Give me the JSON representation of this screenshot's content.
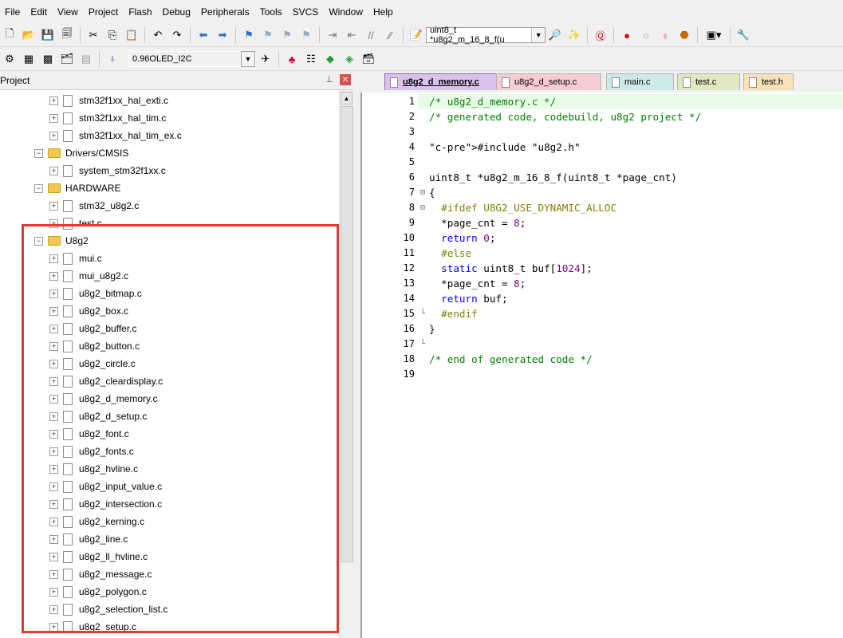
{
  "menu": [
    "File",
    "Edit",
    "View",
    "Project",
    "Flash",
    "Debug",
    "Peripherals",
    "Tools",
    "SVCS",
    "Window",
    "Help"
  ],
  "toolbar": {
    "function_combo": "uint8_t *u8g2_m_16_8_f(u",
    "target_combo": "0.96OLED_I2C"
  },
  "project": {
    "title": "Project",
    "pin_label": "⊥",
    "close_label": "✕",
    "tree": [
      {
        "label": "stm32f1xx_hal_exti.c",
        "type": "file"
      },
      {
        "label": "stm32f1xx_hal_tim.c",
        "type": "file"
      },
      {
        "label": "stm32f1xx_hal_tim_ex.c",
        "type": "file"
      },
      {
        "label": "Drivers/CMSIS",
        "type": "folder"
      },
      {
        "label": "system_stm32f1xx.c",
        "type": "file"
      },
      {
        "label": "HARDWARE",
        "type": "folder"
      },
      {
        "label": "stm32_u8g2.c",
        "type": "file"
      },
      {
        "label": "test.c",
        "type": "file"
      },
      {
        "label": "U8g2",
        "type": "folder"
      },
      {
        "label": "mui.c",
        "type": "file"
      },
      {
        "label": "mui_u8g2.c",
        "type": "file"
      },
      {
        "label": "u8g2_bitmap.c",
        "type": "file"
      },
      {
        "label": "u8g2_box.c",
        "type": "file"
      },
      {
        "label": "u8g2_buffer.c",
        "type": "file"
      },
      {
        "label": "u8g2_button.c",
        "type": "file"
      },
      {
        "label": "u8g2_circle.c",
        "type": "file"
      },
      {
        "label": "u8g2_cleardisplay.c",
        "type": "file"
      },
      {
        "label": "u8g2_d_memory.c",
        "type": "file"
      },
      {
        "label": "u8g2_d_setup.c",
        "type": "file"
      },
      {
        "label": "u8g2_font.c",
        "type": "file"
      },
      {
        "label": "u8g2_fonts.c",
        "type": "file"
      },
      {
        "label": "u8g2_hvline.c",
        "type": "file"
      },
      {
        "label": "u8g2_input_value.c",
        "type": "file"
      },
      {
        "label": "u8g2_intersection.c",
        "type": "file"
      },
      {
        "label": "u8g2_kerning.c",
        "type": "file"
      },
      {
        "label": "u8g2_line.c",
        "type": "file"
      },
      {
        "label": "u8g2_ll_hvline.c",
        "type": "file"
      },
      {
        "label": "u8g2_message.c",
        "type": "file"
      },
      {
        "label": "u8g2_polygon.c",
        "type": "file"
      },
      {
        "label": "u8g2_selection_list.c",
        "type": "file"
      },
      {
        "label": "u8g2_setup.c",
        "type": "file"
      }
    ]
  },
  "tabs": [
    {
      "label": "u8g2_d_memory.c",
      "active": true,
      "color": "#d9c3ee"
    },
    {
      "label": "u8g2_d_setup.c",
      "active": false,
      "color": "#f5cbd6"
    },
    {
      "label": "main.c",
      "active": false,
      "color": "#cdeae6"
    },
    {
      "label": "test.c",
      "active": false,
      "color": "#dfe8c1"
    },
    {
      "label": "test.h",
      "active": false,
      "color": "#f7e2b8"
    }
  ],
  "code_lines": [
    "/* u8g2_d_memory.c */",
    "/* generated code, codebuild, u8g2 project */",
    "",
    "#include \"u8g2.h\"",
    "",
    "uint8_t *u8g2_m_16_8_f(uint8_t *page_cnt)",
    "{",
    "  #ifdef U8G2_USE_DYNAMIC_ALLOC",
    "  *page_cnt = 8;",
    "  return 0;",
    "  #else",
    "  static uint8_t buf[1024];",
    "  *page_cnt = 8;",
    "  return buf;",
    "  #endif",
    "}",
    "",
    "/* end of generated code */",
    ""
  ],
  "colors": {
    "highlight_box": "#e53935",
    "current_line": "#e8fbe7"
  }
}
